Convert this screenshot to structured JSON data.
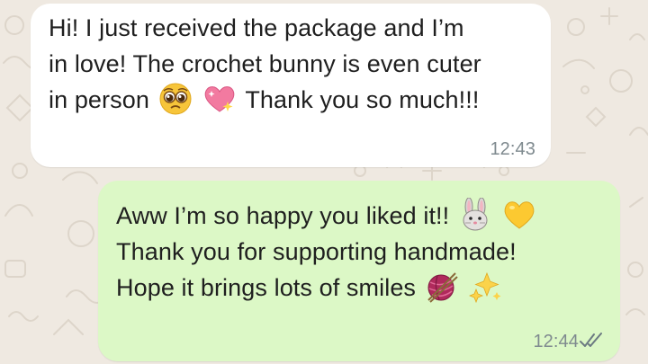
{
  "chat": {
    "incoming": {
      "line1": "Hi! I just received the package and I’m",
      "line2": "in love! The crochet bunny is even cuter",
      "line3_text_before": "in person",
      "line3_text_after": "Thank you so much!!!",
      "emojis": [
        "pleading-face-icon",
        "sparkling-heart-icon"
      ],
      "time": "12:43"
    },
    "outgoing": {
      "line1": "Aww I’m so happy you liked it!!",
      "line1_emojis": [
        "rabbit-face-icon",
        "yellow-heart-icon"
      ],
      "line2": "Thank you for supporting handmade!",
      "line3": "Hope it brings lots of smiles",
      "line3_emojis": [
        "yarn-ball-icon",
        "sparkles-icon"
      ],
      "time": "12:44",
      "status_icon": "double-check-icon"
    }
  },
  "colors": {
    "wallpaper": "#efe9e1",
    "incoming_bubble": "#ffffff",
    "outgoing_bubble": "#dcf8c6",
    "timestamp": "#7f8a8f",
    "text": "#1f1f1f"
  }
}
